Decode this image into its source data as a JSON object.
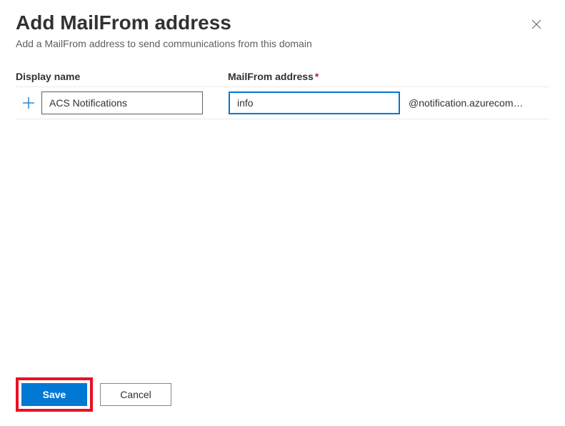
{
  "header": {
    "title": "Add MailFrom address",
    "subtitle": "Add a MailFrom address to send communications from this domain"
  },
  "form": {
    "display_name_label": "Display name",
    "mailfrom_label": "MailFrom address",
    "required_mark": "*",
    "display_name_value": "ACS Notifications",
    "mailfrom_value": "info",
    "domain_suffix": "@notification.azurecom…"
  },
  "footer": {
    "save_label": "Save",
    "cancel_label": "Cancel"
  }
}
